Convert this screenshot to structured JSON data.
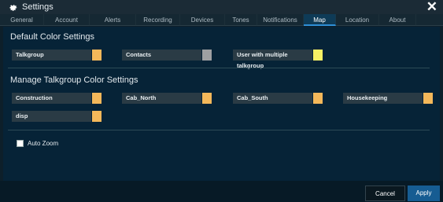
{
  "window": {
    "title": "Settings"
  },
  "tabs": [
    {
      "label": "General",
      "active": false
    },
    {
      "label": "Account",
      "active": false
    },
    {
      "label": "Alerts",
      "active": false
    },
    {
      "label": "Recording",
      "active": false
    },
    {
      "label": "Devices",
      "active": false
    },
    {
      "label": "Tones",
      "active": false
    },
    {
      "label": "Notifications",
      "active": false
    },
    {
      "label": "Map",
      "active": true
    },
    {
      "label": "Location",
      "active": false
    },
    {
      "label": "About",
      "active": false
    }
  ],
  "default_colors": {
    "title": "Default Color Settings",
    "items": [
      {
        "label": "Talkgroup",
        "color": "#f4b85a"
      },
      {
        "label": "Contacts",
        "color": "#9ea0a2"
      },
      {
        "label": "User with multiple talkgroup",
        "color": "#f7f064"
      }
    ]
  },
  "talkgroup_colors": {
    "title": "Manage Talkgroup Color Settings",
    "items": [
      {
        "label": "Construction",
        "color": "#f4b85a"
      },
      {
        "label": "Cab_North",
        "color": "#f4b85a"
      },
      {
        "label": "Cab_South",
        "color": "#f4b85a"
      },
      {
        "label": "Housekeeping",
        "color": "#f4b85a"
      },
      {
        "label": "disp",
        "color": "#f4b85a"
      }
    ]
  },
  "auto_zoom": {
    "label": "Auto Zoom",
    "checked": false
  },
  "footer": {
    "cancel_label": "Cancel",
    "apply_label": "Apply"
  }
}
